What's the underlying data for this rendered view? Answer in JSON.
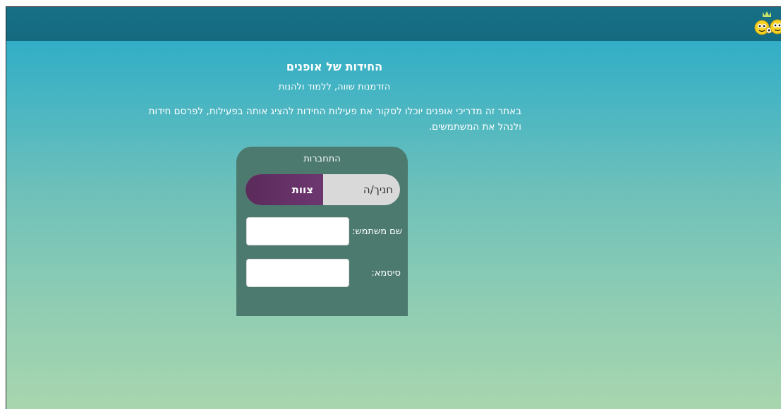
{
  "header": {
    "logo_icon": "kids-characters-logo-icon",
    "bar_color": "#177086"
  },
  "intro": {
    "title": "החידות של אופנים",
    "subtitle": "הזדמנות שווה, ללמוד ולהנות",
    "description": "באתר זה מדריכי אופנים יוכלו לסקור את פעילות החידות להציג אותה בפעילות, לפרסם חידות ולנהל את המשתמשים."
  },
  "login": {
    "title": "התחברות",
    "toggle": {
      "teacher_label": "חניך/ה",
      "staff_label": "צוות",
      "selected": "צוות"
    },
    "username_label": "שם משתמש:",
    "username_value": "",
    "password_label": "סיסמא:",
    "password_value": ""
  },
  "colors": {
    "staff_active": "#5b2b5b",
    "card_bg": "#4c7a6f"
  }
}
